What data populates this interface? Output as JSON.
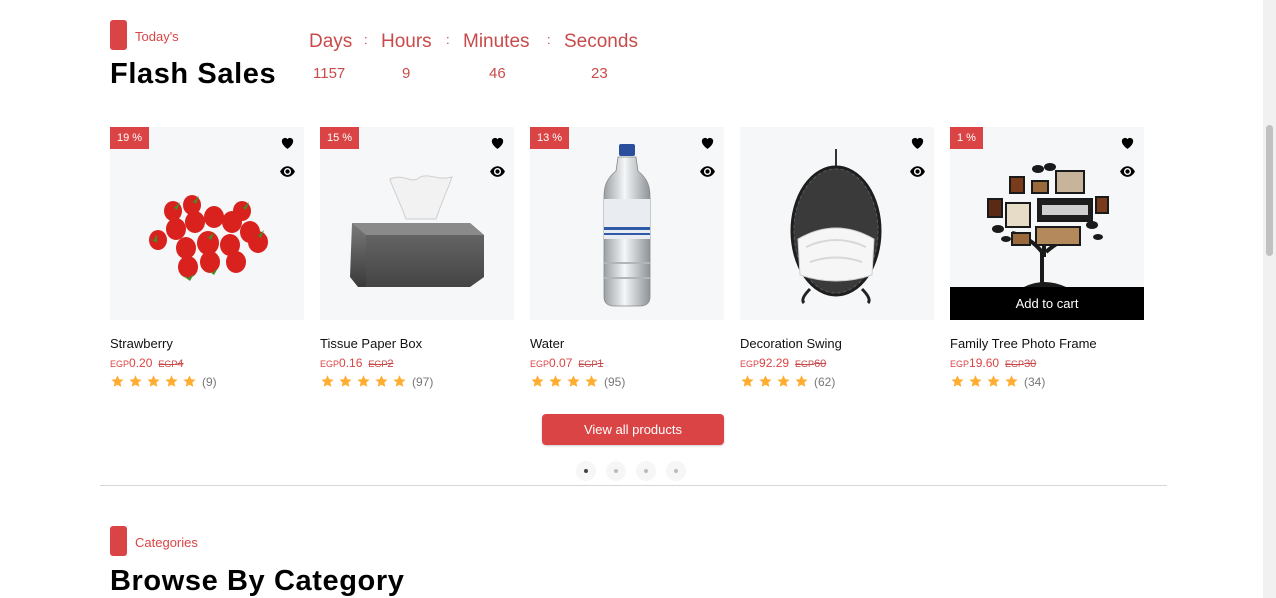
{
  "flash": {
    "tag": "Today's",
    "title": "Flash Sales",
    "countdown": [
      {
        "label": "Days",
        "value": "1157"
      },
      {
        "label": "Hours",
        "value": "9"
      },
      {
        "label": "Minutes",
        "value": "46"
      },
      {
        "label": "Seconds",
        "value": "23"
      }
    ]
  },
  "products": [
    {
      "name": "Strawberry",
      "discount": "19 %",
      "currency": "EGP",
      "price": "0.20",
      "old_currency": "EGP",
      "old_price": "4",
      "rating": 5,
      "reviews": "(9)",
      "image": "strawberries"
    },
    {
      "name": "Tissue Paper Box",
      "discount": "15 %",
      "currency": "EGP",
      "price": "0.16",
      "old_currency": "EGP",
      "old_price": "2",
      "rating": 5,
      "reviews": "(97)",
      "image": "tissue-box"
    },
    {
      "name": "Water",
      "discount": "13 %",
      "currency": "EGP",
      "price": "0.07",
      "old_currency": "EGP",
      "old_price": "1",
      "rating": 4,
      "reviews": "(95)",
      "image": "water-bottle"
    },
    {
      "name": "Decoration Swing",
      "discount": "",
      "currency": "EGP",
      "price": "92.29",
      "old_currency": "EGP",
      "old_price": "60",
      "rating": 4,
      "reviews": "(62)",
      "image": "egg-swing-chair"
    },
    {
      "name": "Family Tree Photo Frame",
      "discount": "1 %",
      "currency": "EGP",
      "price": "19.60",
      "old_currency": "EGP",
      "old_price": "30",
      "rating": 4,
      "reviews": "(34)",
      "image": "family-tree-frame",
      "add_to_cart": "Add to cart"
    }
  ],
  "view_all_label": "View all products",
  "pagination": {
    "count": 4,
    "active": 0
  },
  "categories": {
    "tag": "Categories",
    "title": "Browse By Category"
  },
  "colors": {
    "accent": "#db4444",
    "star": "#ffad33",
    "card_bg": "#f5f7f8"
  },
  "icons": [
    "heart-icon",
    "eye-icon",
    "star-icon"
  ]
}
